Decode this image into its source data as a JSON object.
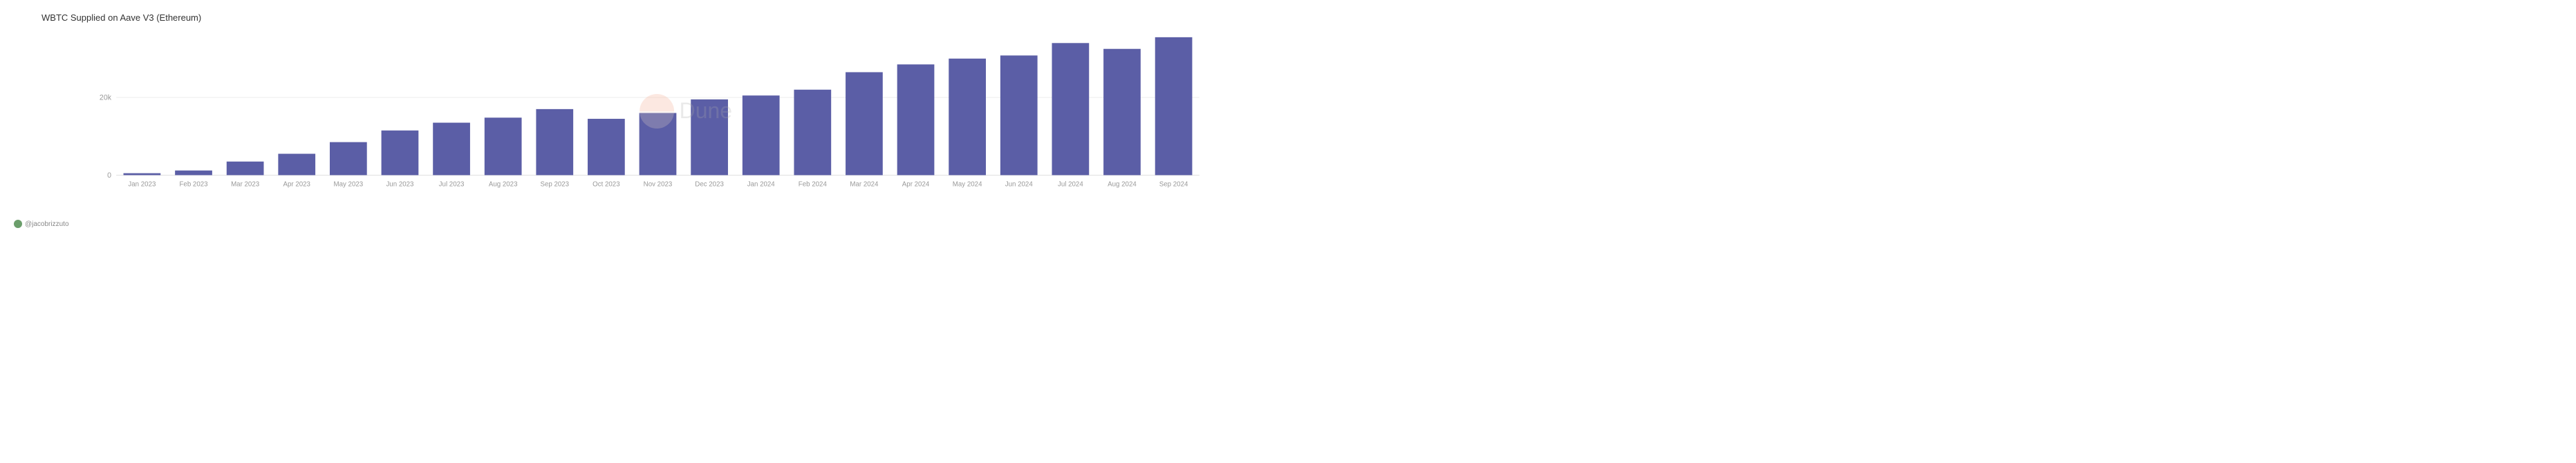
{
  "chart": {
    "title": "WBTC Supplied on Aave V3 (Ethereum)",
    "y_axis": {
      "ticks": [
        {
          "label": "0",
          "pct": 0
        },
        {
          "label": "20k",
          "pct": 50
        }
      ]
    },
    "bars": [
      {
        "label": "Jan 2023",
        "value": 0.5
      },
      {
        "label": "Feb 2023",
        "value": 1.2
      },
      {
        "label": "Mar 2023",
        "value": 3.5
      },
      {
        "label": "Apr 2023",
        "value": 5.5
      },
      {
        "label": "May 2023",
        "value": 8.5
      },
      {
        "label": "Jun 2023",
        "value": 11.5
      },
      {
        "label": "Jul 2023",
        "value": 13.5
      },
      {
        "label": "Aug 2023",
        "value": 14.8
      },
      {
        "label": "Sep 2023",
        "value": 17.0
      },
      {
        "label": "Oct 2023",
        "value": 14.5
      },
      {
        "label": "Nov 2023",
        "value": 16.0
      },
      {
        "label": "Dec 2023",
        "value": 19.5
      },
      {
        "label": "Jan 2024",
        "value": 20.5
      },
      {
        "label": "Feb 2024",
        "value": 22.0
      },
      {
        "label": "Mar 2024",
        "value": 26.5
      },
      {
        "label": "Apr 2024",
        "value": 28.5
      },
      {
        "label": "May 2024",
        "value": 30.0
      },
      {
        "label": "Jun 2024",
        "value": 30.8
      },
      {
        "label": "Jul 2024",
        "value": 34.0
      },
      {
        "label": "Aug 2024",
        "value": 32.5
      },
      {
        "label": "Sep 2024",
        "value": 35.5
      }
    ],
    "max_value": 37,
    "bar_color": "#5b5ea6",
    "watermark": "Dune",
    "attribution": "@jacobrizzuto"
  }
}
